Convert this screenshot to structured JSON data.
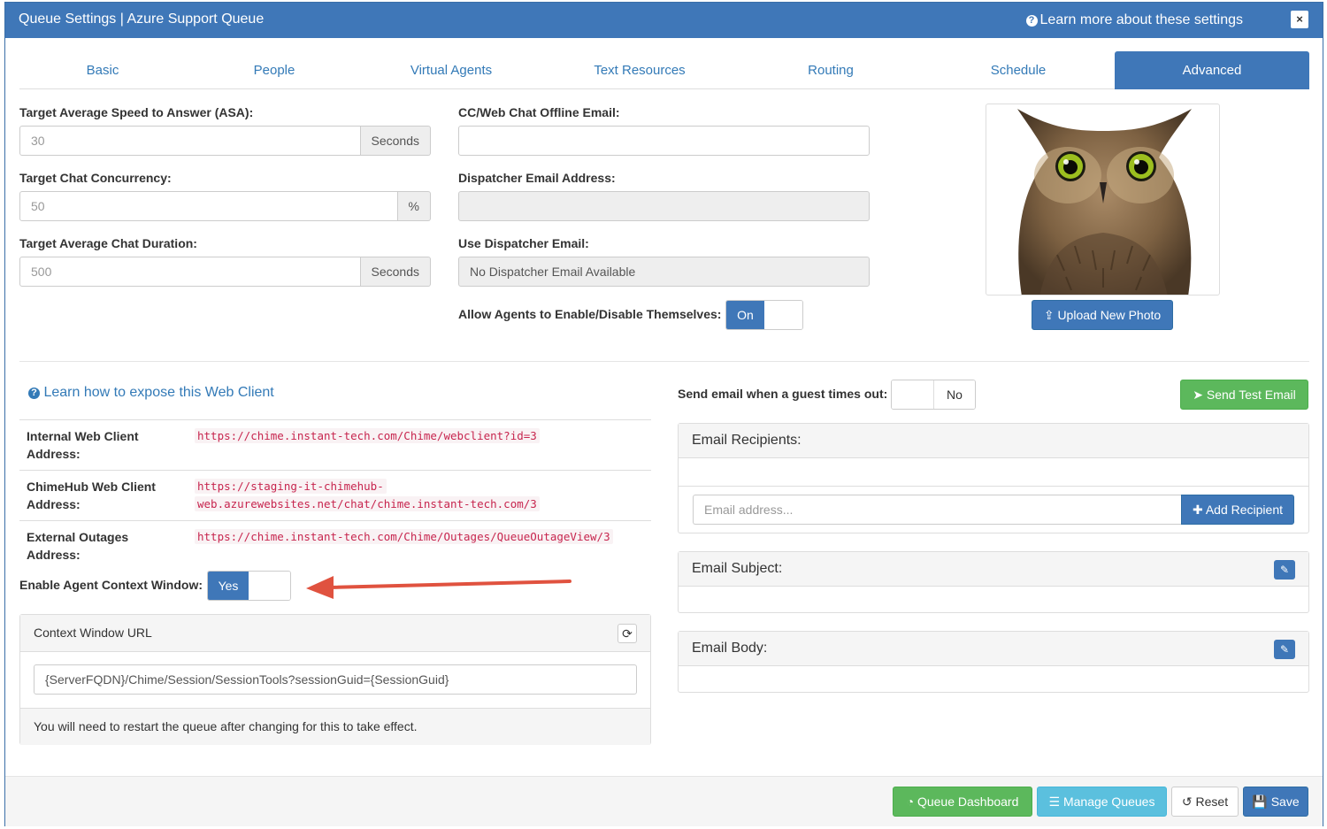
{
  "header": {
    "title": "Queue Settings | Azure Support Queue",
    "learn_more": "Learn more about these settings",
    "close": "×"
  },
  "tabs": [
    {
      "label": "Basic"
    },
    {
      "label": "People"
    },
    {
      "label": "Virtual Agents"
    },
    {
      "label": "Text Resources"
    },
    {
      "label": "Routing"
    },
    {
      "label": "Schedule"
    },
    {
      "label": "Advanced",
      "active": true
    }
  ],
  "left_form": {
    "asa_label": "Target Average Speed to Answer (ASA):",
    "asa_value": "30",
    "asa_unit": "Seconds",
    "concurrency_label": "Target Chat Concurrency:",
    "concurrency_value": "50",
    "concurrency_unit": "%",
    "duration_label": "Target Average Chat Duration:",
    "duration_value": "500",
    "duration_unit": "Seconds"
  },
  "mid_form": {
    "offline_email_label": "CC/Web Chat Offline Email:",
    "offline_email_value": "",
    "dispatcher_email_label": "Dispatcher Email Address:",
    "dispatcher_email_value": "",
    "use_dispatcher_label": "Use Dispatcher Email:",
    "use_dispatcher_value": "No Dispatcher Email Available",
    "allow_agents_label": "Allow Agents to Enable/Disable Themselves:",
    "allow_agents_state": "On"
  },
  "photo": {
    "upload_label": "Upload New Photo"
  },
  "web_client": {
    "learn_link": "Learn how to expose this Web Client",
    "rows": [
      {
        "label_line1": "Internal Web Client",
        "label_line2": "Address:",
        "url_line1": "https://chime.instant-tech.com/Chime/webclient?id=3",
        "url_line2": ""
      },
      {
        "label_line1": "ChimeHub Web Client",
        "label_line2": "Address:",
        "url_line1": "https://staging-it-chimehub-",
        "url_line2": "web.azurewebsites.net/chat/chime.instant-tech.com/3"
      },
      {
        "label_line1": "External Outages",
        "label_line2": "Address:",
        "url_line1": "https://chime.instant-tech.com/Chime/Outages/QueueOutageView/3",
        "url_line2": ""
      }
    ],
    "context_toggle_label": "Enable Agent Context Window:",
    "context_toggle_state": "Yes"
  },
  "context_panel": {
    "title": "Context Window URL",
    "url_value": "{ServerFQDN}/Chime/Session/SessionTools?sessionGuid={SessionGuid}",
    "note": "You will need to restart the queue after changing for this to take effect."
  },
  "email": {
    "timeout_label": "Send email when a guest times out:",
    "timeout_state": "No",
    "send_test_label": "Send Test Email",
    "recipients_title": "Email Recipients:",
    "recipient_placeholder": "Email address...",
    "add_recipient_label": "Add Recipient",
    "subject_title": "Email Subject:",
    "body_title": "Email Body:"
  },
  "footer": {
    "dashboard_label": "Queue Dashboard",
    "manage_label": "Manage Queues",
    "reset_label": "Reset",
    "save_label": "Save"
  },
  "colors": {
    "primary": "#3f77b8",
    "success": "#5cb85c",
    "info": "#5bc0de",
    "code": "#c7254e",
    "arrow": "#e0523f"
  }
}
